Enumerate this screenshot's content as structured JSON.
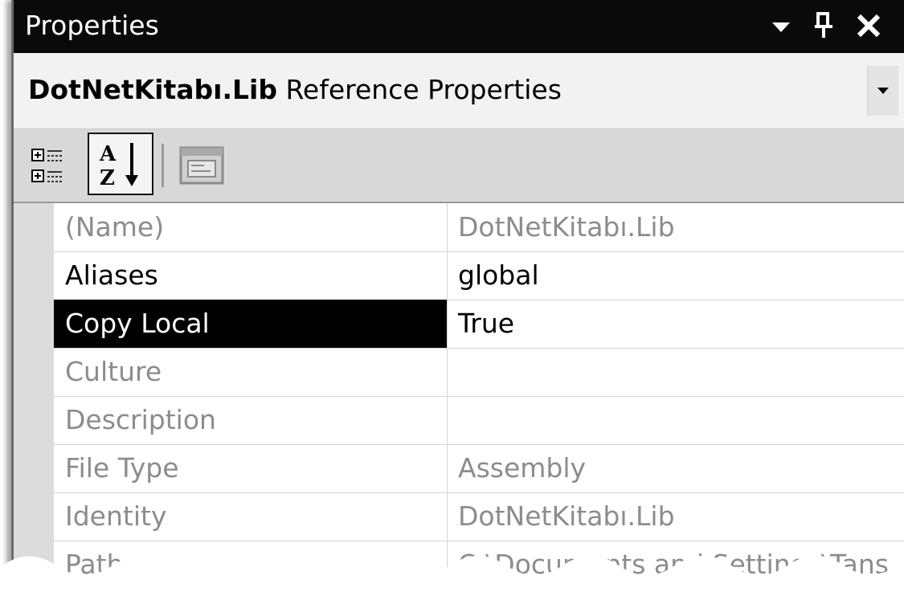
{
  "window": {
    "title": "Properties",
    "dropdown_icon": "chevron-down-icon",
    "pin_icon": "pin-icon",
    "close_icon": "close-icon"
  },
  "object_selector": {
    "object_name": "DotNetKitabı.Lib",
    "object_type": "Reference Properties"
  },
  "toolbar": {
    "buttons": [
      {
        "name": "categorized",
        "icon": "categorized-icon"
      },
      {
        "name": "alphabetical",
        "icon": "alphabetical-sort-icon",
        "active": true
      },
      {
        "name": "property-pages",
        "icon": "property-pages-icon"
      }
    ]
  },
  "properties": [
    {
      "name": "(Name)",
      "value": "DotNetKitabı.Lib"
    },
    {
      "name": "Aliases",
      "value": "global"
    },
    {
      "name": "Copy Local",
      "value": "True"
    },
    {
      "name": "Culture",
      "value": ""
    },
    {
      "name": "Description",
      "value": ""
    },
    {
      "name": "File Type",
      "value": "Assembly"
    },
    {
      "name": "Identity",
      "value": "DotNetKitabı.Lib"
    },
    {
      "name": "Path",
      "value": "C:\\Documents and Settings\\Tans"
    }
  ],
  "colors": {
    "titlebar": "#0a0a0a",
    "selected_row": "#000000",
    "readonly_text": "#8c8c8c"
  }
}
